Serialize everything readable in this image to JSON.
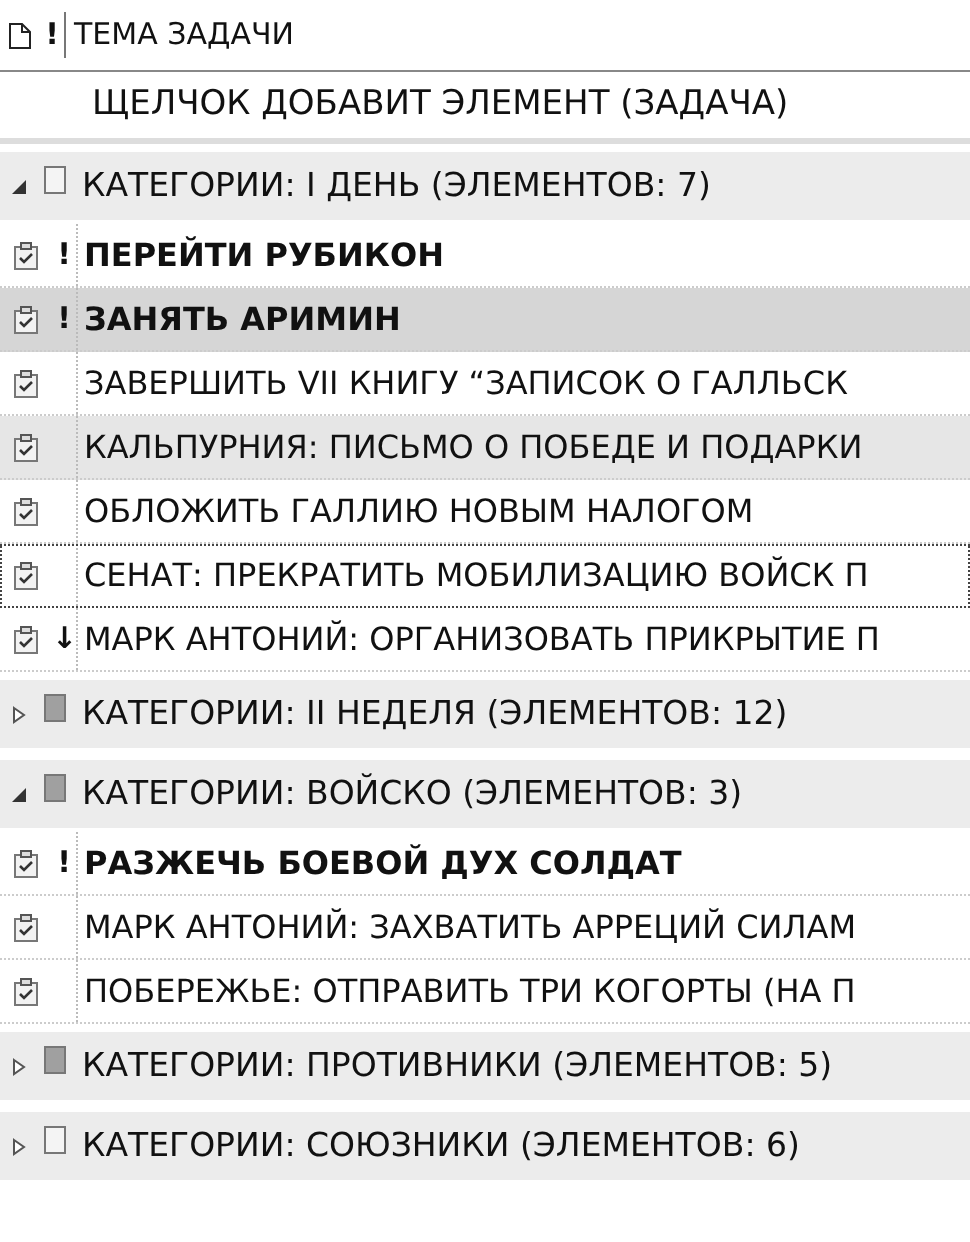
{
  "header": {
    "column_2": "!",
    "subject_column": "ТЕМА ЗАДАЧИ"
  },
  "new_item": {
    "placeholder": "ЩЕЛЧОК ДОБАВИТ ЭЛЕМЕНТ (ЗАДАЧА)"
  },
  "groups": [
    {
      "label": "КАТЕГОРИИ: I ДЕНЬ (ЭЛЕМЕНТОВ: 7)",
      "expanded": true,
      "color": "#f4f4f4",
      "tasks": [
        {
          "subject": "ПЕРЕЙТИ РУБИКОН",
          "priority": "!",
          "bold": true,
          "selected": false,
          "hover": false,
          "focused": false
        },
        {
          "subject": "ЗАНЯТЬ АРИМИН",
          "priority": "!",
          "bold": true,
          "selected": true,
          "hover": false,
          "focused": false
        },
        {
          "subject": "ЗАВЕРШИТЬ VII КНИГУ “ЗАПИСОК О ГАЛЛЬСК",
          "bold": false,
          "selected": false,
          "hover": false,
          "focused": false
        },
        {
          "subject": "КАЛЬПУРНИЯ: ПИСЬМО О ПОБЕДЕ И ПОДАРКИ",
          "bold": false,
          "selected": false,
          "hover": true,
          "focused": false
        },
        {
          "subject": "ОБЛОЖИТЬ ГАЛЛИЮ НОВЫМ НАЛОГОМ",
          "bold": false,
          "selected": false,
          "hover": false,
          "focused": false
        },
        {
          "subject": "СЕНАТ: ПРЕКРАТИТЬ МОБИЛИЗАЦИЮ ВОЙСК П",
          "bold": false,
          "selected": false,
          "hover": false,
          "focused": true
        },
        {
          "subject": "МАРК АНТОНИЙ: ОРГАНИЗОВАТЬ ПРИКРЫТИЕ П",
          "priority": "↓",
          "bold": false,
          "selected": false,
          "hover": false,
          "focused": false
        }
      ]
    },
    {
      "label": "КАТЕГОРИИ: II НЕДЕЛЯ (ЭЛЕМЕНТОВ: 12)",
      "expanded": false,
      "color": "#a0a0a0"
    },
    {
      "label": "КАТЕГОРИИ: ВОЙСКО (ЭЛЕМЕНТОВ: 3)",
      "expanded": true,
      "color": "#a0a0a0",
      "tasks": [
        {
          "subject": "РАЗЖЕЧЬ БОЕВОЙ ДУХ СОЛДАТ",
          "priority": "!",
          "bold": true,
          "selected": false,
          "hover": false,
          "focused": false
        },
        {
          "subject": "МАРК АНТОНИЙ: ЗАХВАТИТЬ АРРЕЦИЙ СИЛАМ",
          "bold": false,
          "selected": false,
          "hover": false,
          "focused": false
        },
        {
          "subject": "ПОБЕРЕЖЬЕ: ОТПРАВИТЬ ТРИ КОГОРТЫ (НА П",
          "bold": false,
          "selected": false,
          "hover": false,
          "focused": false
        }
      ]
    },
    {
      "label": "КАТЕГОРИИ: ПРОТИВНИКИ (ЭЛЕМЕНТОВ: 5)",
      "expanded": false,
      "color": "#a0a0a0"
    },
    {
      "label": "КАТЕГОРИИ: СОЮЗНИКИ (ЭЛЕМЕНТОВ: 6)",
      "expanded": false,
      "color": "#f4f4f4"
    }
  ]
}
